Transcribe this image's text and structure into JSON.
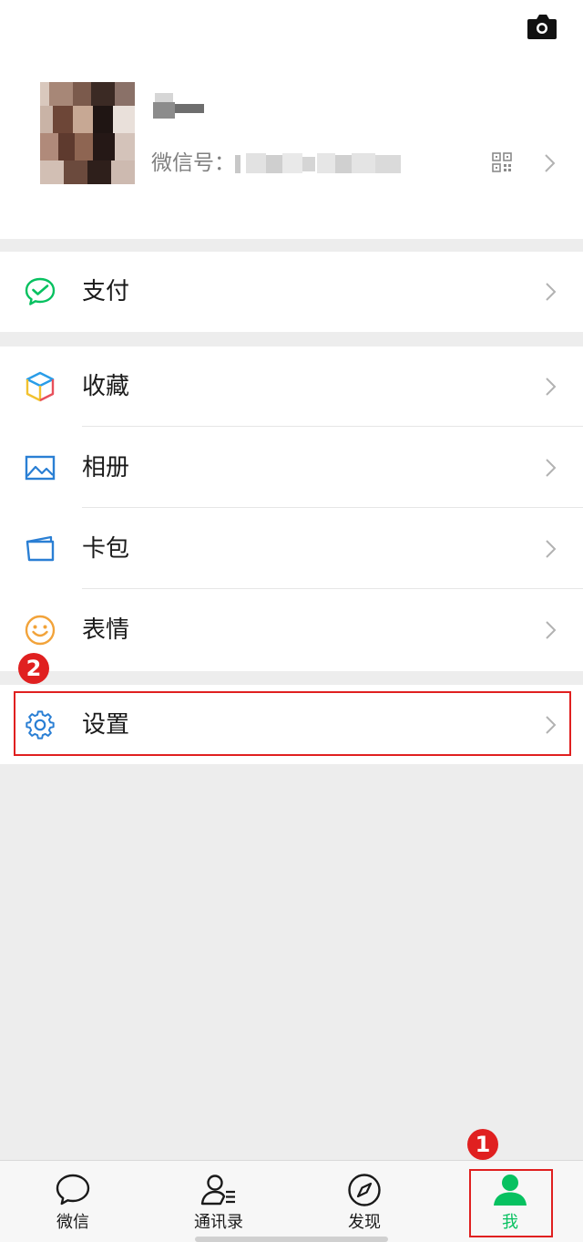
{
  "profile": {
    "wechat_id_label": "微信号：",
    "avatar_icon": "avatar-pixelated",
    "qr_icon": "qr-code-icon",
    "camera_icon": "camera-icon"
  },
  "menu": {
    "pay": {
      "label": "支付",
      "icon": "pay-icon",
      "color": "#07c160"
    },
    "favorites": {
      "label": "收藏",
      "icon": "cube-icon"
    },
    "album": {
      "label": "相册",
      "icon": "image-icon",
      "color": "#2a7fd4"
    },
    "cards": {
      "label": "卡包",
      "icon": "wallet-icon",
      "color": "#2a7fd4"
    },
    "stickers": {
      "label": "表情",
      "icon": "smiley-icon",
      "color": "#f2a33a"
    },
    "settings": {
      "label": "设置",
      "icon": "gear-icon",
      "color": "#2a7fd4"
    }
  },
  "annotations": {
    "step1": "1",
    "step2": "2",
    "highlight_color": "#e02020"
  },
  "tabbar": {
    "tabs": [
      {
        "label": "微信",
        "icon": "chat-bubble-icon",
        "active": false
      },
      {
        "label": "通讯录",
        "icon": "contacts-icon",
        "active": false
      },
      {
        "label": "发现",
        "icon": "compass-icon",
        "active": false
      },
      {
        "label": "我",
        "icon": "person-icon",
        "active": true
      }
    ],
    "active_color": "#07c160"
  }
}
